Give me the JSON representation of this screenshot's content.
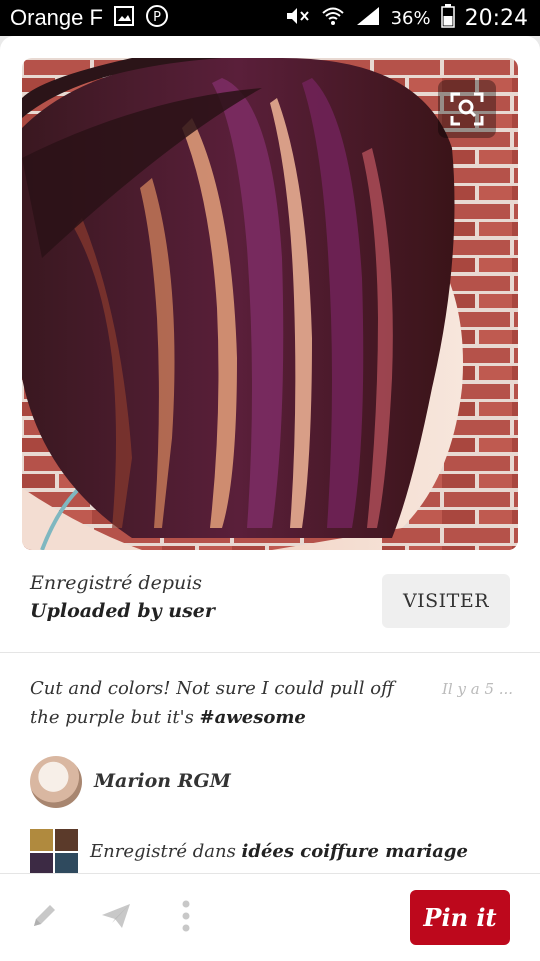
{
  "status_bar": {
    "carrier": "Orange F",
    "battery": "36%",
    "time": "20:24"
  },
  "pin": {
    "saved_from_label": "Enregistré depuis",
    "source": "Uploaded by user",
    "visit_label": "VISITER",
    "description_text": "Cut and colors! Not sure I could pull off the purple but it's ",
    "description_tag": "#awesome",
    "time_ago": "Il y a 5 ...",
    "user_name": "Marion RGM",
    "saved_in_prefix": "Enregistré dans ",
    "board_name": "idées coiffure mariage"
  },
  "toolbar": {
    "pin_it_label": "Pin it"
  },
  "colors": {
    "accent": "#bd081c"
  }
}
